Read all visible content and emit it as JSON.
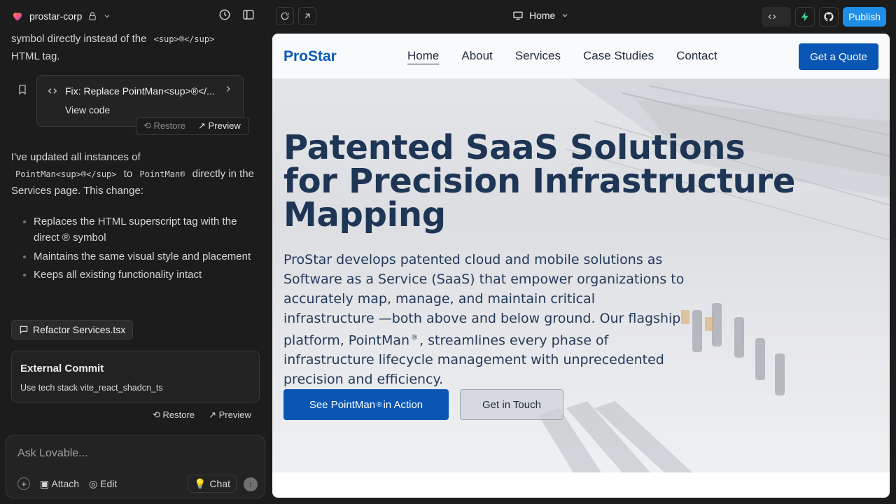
{
  "topbar": {
    "project_name": "prostar-corp",
    "page_selector": "Home",
    "publish_label": "Publish",
    "colors": {
      "accent": "#1f8ee6",
      "supabase": "#3ecf8e"
    }
  },
  "chat": {
    "msg1_text": "symbol directly instead of the",
    "msg1_code": "<sup>®</sup>",
    "msg1_end": "HTML tag.",
    "fix_card": {
      "title": "Fix: Replace PointMan<sup>®</...",
      "view_code": "View code",
      "restore": "Restore",
      "preview": "Preview"
    },
    "msg2_intro": "I've updated all instances of",
    "msg2_code1": "PointMan<sup>®</sup>",
    "msg2_to": "to",
    "msg2_code2": "PointMan®",
    "msg2_after": "directly in the Services page. This change:",
    "bullets": [
      "Replaces the HTML superscript tag with the direct ® symbol",
      "Maintains the same visual style and placement",
      "Keeps all existing functionality intact"
    ],
    "refactor_label": "Refactor Services.tsx",
    "commit": {
      "title": "External Commit",
      "subtitle": "Use tech stack vite_react_shadcn_ts",
      "restore": "Restore",
      "preview": "Preview"
    },
    "input": {
      "placeholder": "Ask Lovable...",
      "attach": "Attach",
      "edit": "Edit",
      "chat": "Chat"
    }
  },
  "site": {
    "logo": "ProStar",
    "nav": [
      "Home",
      "About",
      "Services",
      "Case Studies",
      "Contact"
    ],
    "cta": "Get a Quote",
    "hero_title": "Patented SaaS Solutions for Precision Infrastructure Mapping",
    "hero_text_a": "ProStar develops patented cloud and mobile solutions as Software as a Service (SaaS) that empower organizations to accurately map, manage, and maintain critical infrastructure —both above and below ground. Our flagship platform, PointMan",
    "hero_text_sup": "®",
    "hero_text_b": ", streamlines every phase of infrastructure lifecycle management with unprecedented precision and efficiency.",
    "btn_primary_a": "See PointMan",
    "btn_primary_sup": "®",
    "btn_primary_b": "in Action",
    "btn_secondary": "Get in Touch",
    "colors": {
      "brand": "#0a56b4",
      "heading": "#1f3555"
    }
  }
}
